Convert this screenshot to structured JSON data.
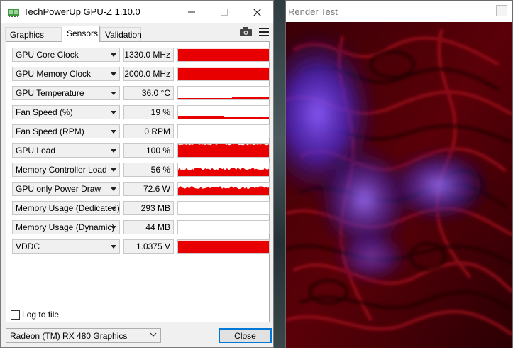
{
  "gpuz": {
    "title": "TechPowerUp GPU-Z 1.10.0",
    "tabs": [
      {
        "label": "Graphics Card",
        "active": false
      },
      {
        "label": "Sensors",
        "active": true
      },
      {
        "label": "Validation",
        "active": false
      }
    ],
    "toolbar_icons": [
      "camera-icon",
      "menu-icon"
    ],
    "sensors": [
      {
        "name": "GPU Core Clock",
        "value": "1330.0 MHz",
        "graph_level": 0.95,
        "graph": "full"
      },
      {
        "name": "GPU Memory Clock",
        "value": "2000.0 MHz",
        "graph_level": 0.95,
        "graph": "full"
      },
      {
        "name": "GPU Temperature",
        "value": "36.0 °C",
        "graph_level": 0.2,
        "graph": "low"
      },
      {
        "name": "Fan Speed (%)",
        "value": "19 %",
        "graph_level": 0.2,
        "graph": "step"
      },
      {
        "name": "Fan Speed (RPM)",
        "value": "0 RPM",
        "graph_level": 0,
        "graph": "none"
      },
      {
        "name": "GPU Load",
        "value": "100 %",
        "graph_level": 1.0,
        "graph": "noisy-high"
      },
      {
        "name": "Memory Controller Load",
        "value": "56 %",
        "graph_level": 0.56,
        "graph": "noisy-mid"
      },
      {
        "name": "GPU only Power Draw",
        "value": "72.6 W",
        "graph_level": 0.6,
        "graph": "noisy-mid"
      },
      {
        "name": "Memory Usage (Dedicated)",
        "value": "293 MB",
        "graph_level": 0.05,
        "graph": "line"
      },
      {
        "name": "Memory Usage (Dynamic)",
        "value": "44 MB",
        "graph_level": 0,
        "graph": "none"
      },
      {
        "name": "VDDC",
        "value": "1.0375 V",
        "graph_level": 0.95,
        "graph": "full"
      }
    ],
    "log_to_file": {
      "label": "Log to file",
      "checked": false
    },
    "gpu_select": "Radeon (TM) RX 480 Graphics",
    "close_label": "Close",
    "colors": {
      "graph": "#e80000",
      "accent": "#0078d7"
    }
  },
  "render_window": {
    "title": "Render Test"
  }
}
